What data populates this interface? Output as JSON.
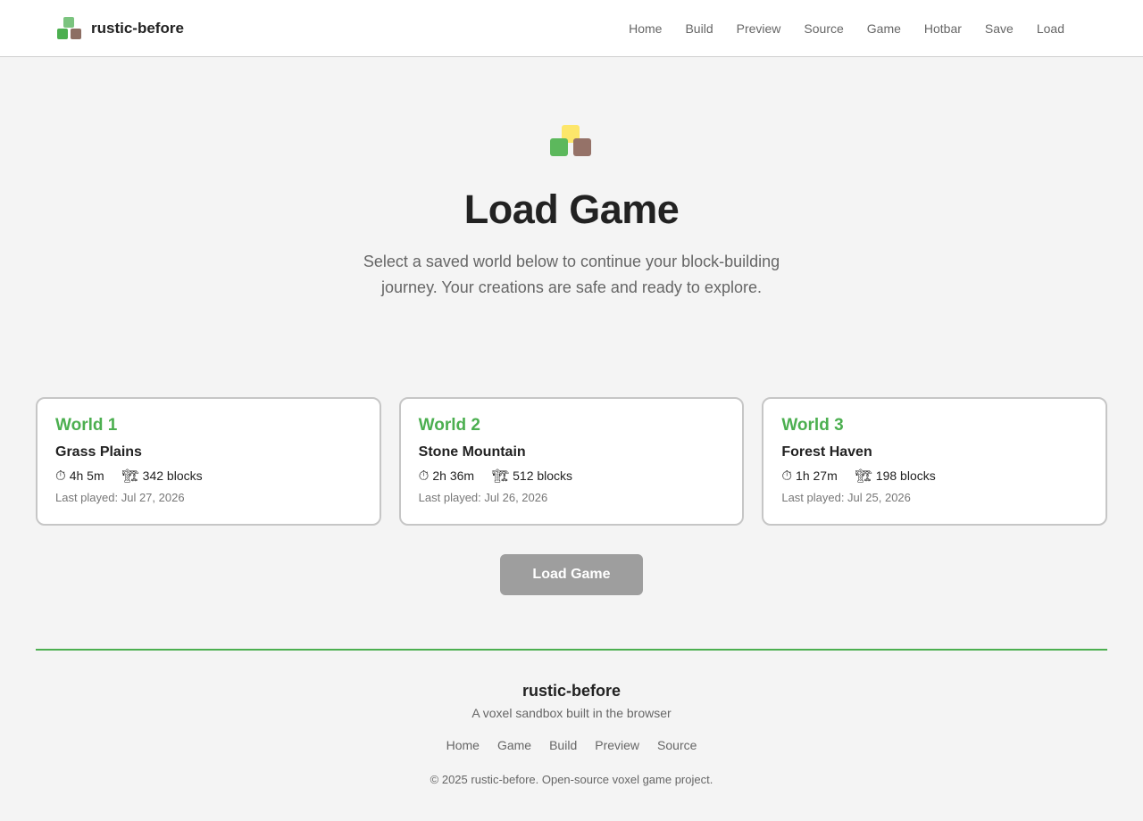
{
  "header": {
    "brand_name": "rustic-before",
    "logo_icon": "block-stack-logo-icon",
    "nav": [
      "Home",
      "Build",
      "Preview",
      "Source",
      "Game",
      "Hotbar",
      "Save",
      "Load"
    ]
  },
  "hero": {
    "icon": "block-stack-logo-icon",
    "title": "Load Game",
    "subtitle": "Select a saved world below to continue your block-building journey. Your creations are safe and ready to explore."
  },
  "worlds": [
    {
      "slot": "World 1",
      "name": "Grass Plains",
      "playtime": "4h 5m",
      "blocks": "342 blocks",
      "last_played": "Last played: Jul 27, 2026"
    },
    {
      "slot": "World 2",
      "name": "Stone Mountain",
      "playtime": "2h 36m",
      "blocks": "512 blocks",
      "last_played": "Last played: Jul 26, 2026"
    },
    {
      "slot": "World 3",
      "name": "Forest Haven",
      "playtime": "1h 27m",
      "blocks": "198 blocks",
      "last_played": "Last played: Jul 25, 2026"
    }
  ],
  "icons": {
    "playtime": "⏱",
    "blocks": "🏗"
  },
  "load_button": {
    "label": "Load Game"
  },
  "footer": {
    "name": "rustic-before",
    "tagline": "A voxel sandbox built in the browser",
    "links": [
      "Home",
      "Game",
      "Build",
      "Preview",
      "Source"
    ],
    "copyright": "© 2025 rustic-before. Open-source voxel game project."
  },
  "colors": {
    "accent": "#4caf50",
    "button_disabled": "#9e9e9e",
    "brand_green": "#7bc47f",
    "brand_brown": "#8d6e63",
    "brand_yellow": "#fde66a"
  }
}
